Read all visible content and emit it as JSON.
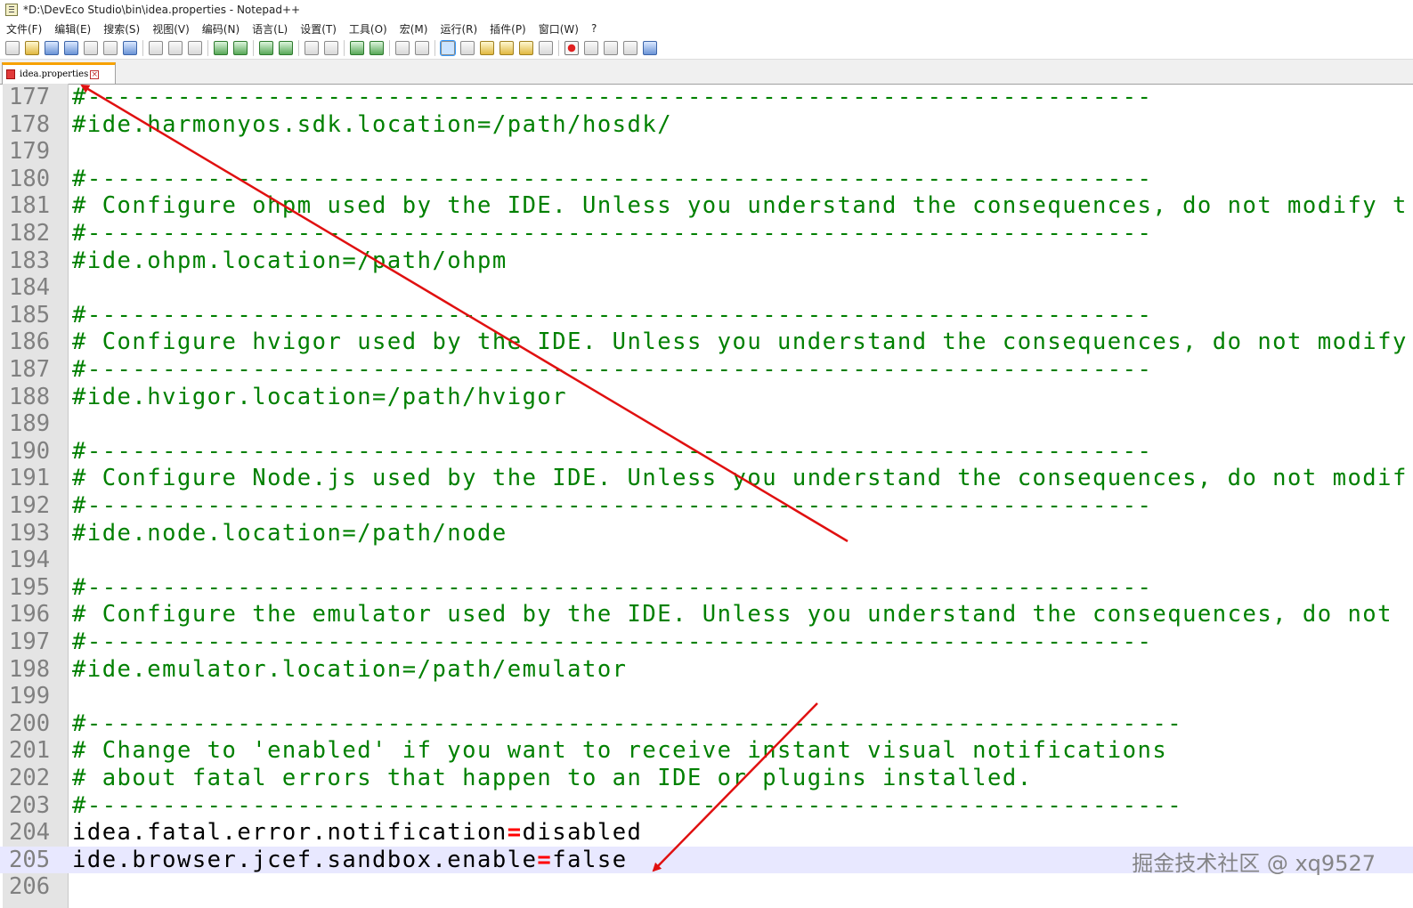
{
  "window": {
    "title": "*D:\\DevEco Studio\\bin\\idea.properties - Notepad++"
  },
  "menu": [
    "文件(F)",
    "编辑(E)",
    "搜索(S)",
    "视图(V)",
    "编码(N)",
    "语言(L)",
    "设置(T)",
    "工具(O)",
    "宏(M)",
    "运行(R)",
    "插件(P)",
    "窗口(W)",
    "?"
  ],
  "toolbar_icons": [
    "new-file-icon",
    "open-file-icon",
    "save-icon",
    "save-all-icon",
    "close-icon",
    "close-all-icon",
    "print-icon",
    "sep",
    "cut-icon",
    "copy-icon",
    "paste-icon",
    "sep",
    "undo-icon",
    "redo-icon",
    "sep",
    "find-icon",
    "replace-icon",
    "sep",
    "zoom-in-icon",
    "zoom-out-icon",
    "sep",
    "sync-vertical-icon",
    "sync-horizontal-icon",
    "sep",
    "word-wrap-icon",
    "show-all-chars-icon",
    "sep",
    "indent-guide-icon",
    "udl-icon",
    "doc-map-icon",
    "function-list-icon",
    "folder-workspace-icon",
    "monitoring-icon",
    "sep",
    "record-macro-icon",
    "stop-record-icon",
    "play-macro-icon",
    "run-macro-multiple-icon",
    "save-macro-icon"
  ],
  "tab": {
    "label": "idea.properties"
  },
  "editor": {
    "lines": [
      {
        "num": "177",
        "text": "#-----------------------------------------------------------------------",
        "kind": "comment"
      },
      {
        "num": "178",
        "text": "#ide.harmonyos.sdk.location=/path/hosdk/",
        "kind": "comment"
      },
      {
        "num": "179",
        "text": "",
        "kind": "comment"
      },
      {
        "num": "180",
        "text": "#-----------------------------------------------------------------------",
        "kind": "comment"
      },
      {
        "num": "181",
        "text": "# Configure ohpm used by the IDE. Unless you understand the consequences, do not modify t",
        "kind": "comment"
      },
      {
        "num": "182",
        "text": "#-----------------------------------------------------------------------",
        "kind": "comment"
      },
      {
        "num": "183",
        "text": "#ide.ohpm.location=/path/ohpm",
        "kind": "comment"
      },
      {
        "num": "184",
        "text": "",
        "kind": "comment"
      },
      {
        "num": "185",
        "text": "#-----------------------------------------------------------------------",
        "kind": "comment"
      },
      {
        "num": "186",
        "text": "# Configure hvigor used by the IDE. Unless you understand the consequences, do not modify",
        "kind": "comment"
      },
      {
        "num": "187",
        "text": "#-----------------------------------------------------------------------",
        "kind": "comment"
      },
      {
        "num": "188",
        "text": "#ide.hvigor.location=/path/hvigor",
        "kind": "comment"
      },
      {
        "num": "189",
        "text": "",
        "kind": "comment"
      },
      {
        "num": "190",
        "text": "#-----------------------------------------------------------------------",
        "kind": "comment"
      },
      {
        "num": "191",
        "text": "# Configure Node.js used by the IDE. Unless you understand the consequences, do not modif",
        "kind": "comment"
      },
      {
        "num": "192",
        "text": "#-----------------------------------------------------------------------",
        "kind": "comment"
      },
      {
        "num": "193",
        "text": "#ide.node.location=/path/node",
        "kind": "comment"
      },
      {
        "num": "194",
        "text": "",
        "kind": "comment"
      },
      {
        "num": "195",
        "text": "#-----------------------------------------------------------------------",
        "kind": "comment"
      },
      {
        "num": "196",
        "text": "# Configure the emulator used by the IDE. Unless you understand the consequences, do not",
        "kind": "comment"
      },
      {
        "num": "197",
        "text": "#-----------------------------------------------------------------------",
        "kind": "comment"
      },
      {
        "num": "198",
        "text": "#ide.emulator.location=/path/emulator",
        "kind": "comment"
      },
      {
        "num": "199",
        "text": "",
        "kind": "comment"
      },
      {
        "num": "200",
        "text": "#-------------------------------------------------------------------------",
        "kind": "comment"
      },
      {
        "num": "201",
        "text": "# Change to 'enabled' if you want to receive instant visual notifications",
        "kind": "comment"
      },
      {
        "num": "202",
        "text": "# about fatal errors that happen to an IDE or plugins installed.",
        "kind": "comment"
      },
      {
        "num": "203",
        "text": "#-------------------------------------------------------------------------",
        "kind": "comment"
      },
      {
        "num": "204",
        "text": "",
        "kind": "property",
        "key": "idea.fatal.error.notification",
        "eq": "=",
        "value": "disabled"
      },
      {
        "num": "205",
        "text": "",
        "kind": "property",
        "key": "ide.browser.jcef.sandbox.enable",
        "eq": "=",
        "value": "false",
        "current": true
      },
      {
        "num": "206",
        "text": "",
        "kind": "comment"
      }
    ]
  },
  "watermark": "掘金技术社区 @ xq9527",
  "colors": {
    "comment": "#008000",
    "operator": "#ff0000",
    "current_line": "#e8e8ff",
    "annotation_arrow": "#e01010"
  }
}
